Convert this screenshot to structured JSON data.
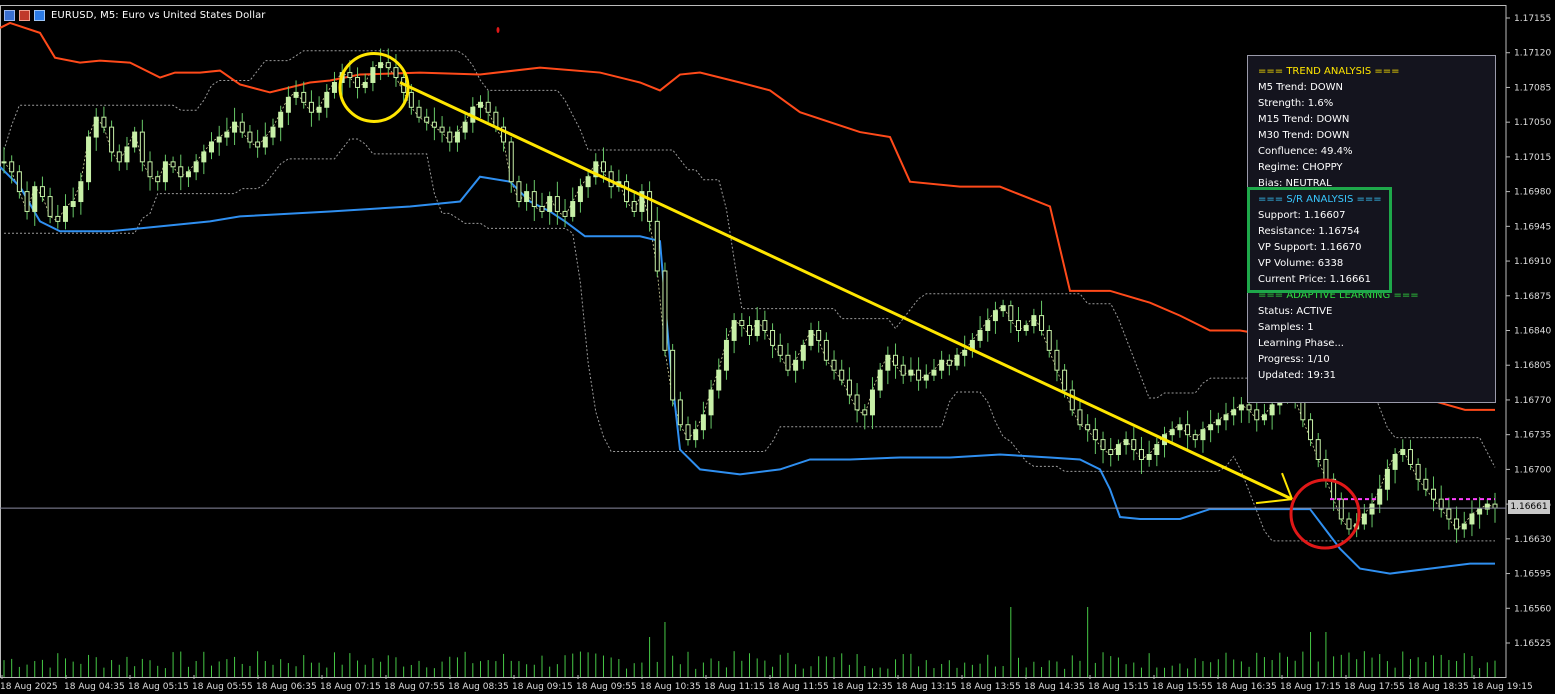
{
  "window": {
    "title": "EURUSD, M5:  Euro vs United States Dollar"
  },
  "colors": {
    "background": "#000000",
    "candle_up": "#c8f0a8",
    "wick": "#68c868",
    "upper_band": "#ff4a1a",
    "lower_band": "#2f8ff0",
    "envelope": "#9a9a9a",
    "trend_line": "#ffe600",
    "circle_top": "#ffe600",
    "circle_bottom": "#e01818",
    "magenta_level": "#ff40ff",
    "volume": "#46c846",
    "price_line": "#8a8aa0"
  },
  "price_axis": {
    "labels": [
      "1.17155",
      "1.17120",
      "1.17085",
      "1.17050",
      "1.17015",
      "1.16980",
      "1.16945",
      "1.16910",
      "1.16875",
      "1.16840",
      "1.16805",
      "1.16770",
      "1.16735",
      "1.16700",
      "1.16665",
      "1.16630",
      "1.16595",
      "1.16560",
      "1.16525"
    ],
    "values": [
      1.17155,
      1.1712,
      1.17085,
      1.1705,
      1.17015,
      1.1698,
      1.16945,
      1.1691,
      1.16875,
      1.1684,
      1.16805,
      1.1677,
      1.16735,
      1.167,
      1.16665,
      1.1663,
      1.16595,
      1.1656,
      1.16525
    ],
    "current_price_label": "1.16661",
    "current_price": 1.16661
  },
  "time_axis": {
    "labels": [
      "18 Aug 2025",
      "18 Aug 04:35",
      "18 Aug 05:15",
      "18 Aug 05:55",
      "18 Aug 06:35",
      "18 Aug 07:15",
      "18 Aug 07:55",
      "18 Aug 08:35",
      "18 Aug 09:15",
      "18 Aug 09:55",
      "18 Aug 10:35",
      "18 Aug 11:15",
      "18 Aug 11:55",
      "18 Aug 12:35",
      "18 Aug 13:15",
      "18 Aug 13:55",
      "18 Aug 14:35",
      "18 Aug 15:15",
      "18 Aug 15:55",
      "18 Aug 16:35",
      "18 Aug 17:15",
      "18 Aug 17:55",
      "18 Aug 18:35",
      "18 Aug 19:15"
    ]
  },
  "info_panel": {
    "trend_header": "=== TREND ANALYSIS ===",
    "trend_lines": [
      "M5 Trend: DOWN",
      "Strength: 1.6%",
      "M15 Trend: DOWN",
      "M30 Trend: DOWN",
      "Confluence: 49.4%",
      "Regime: CHOPPY",
      "Bias: NEUTRAL"
    ],
    "sr_header": "=== S/R ANALYSIS ===",
    "sr_lines": [
      "Support: 1.16607",
      "Resistance: 1.16754",
      "VP Support: 1.16670",
      "VP Volume: 6338",
      "Current Price: 1.16661"
    ],
    "learn_header": "=== ADAPTIVE LEARNING ===",
    "learn_lines": [
      "Status: ACTIVE",
      "Samples: 1",
      "Learning Phase...",
      "Progress: 1/10",
      "Updated: 19:31"
    ]
  },
  "chart_data": {
    "type": "candlestick",
    "symbol": "EURUSD",
    "timeframe": "M5",
    "ylim": [
      1.1651,
      1.1717
    ],
    "bar_count": 195,
    "closes": [
      1.1701,
      1.17,
      1.1698,
      1.1696,
      1.16985,
      1.16975,
      1.16955,
      1.1695,
      1.16965,
      1.1697,
      1.1699,
      1.17035,
      1.17055,
      1.17045,
      1.1702,
      1.1701,
      1.17025,
      1.1704,
      1.1701,
      1.16995,
      1.1699,
      1.1701,
      1.17005,
      1.16995,
      1.17,
      1.1701,
      1.1702,
      1.1703,
      1.17035,
      1.1704,
      1.1705,
      1.1704,
      1.1703,
      1.17025,
      1.17035,
      1.17045,
      1.1706,
      1.17075,
      1.1708,
      1.1707,
      1.1706,
      1.17065,
      1.1708,
      1.1709,
      1.171,
      1.17095,
      1.17085,
      1.1709,
      1.17105,
      1.1711,
      1.17105,
      1.17095,
      1.1708,
      1.17065,
      1.17055,
      1.1705,
      1.17045,
      1.1704,
      1.1703,
      1.1704,
      1.1705,
      1.17065,
      1.1707,
      1.1706,
      1.17045,
      1.1703,
      1.1699,
      1.1697,
      1.1698,
      1.16965,
      1.1696,
      1.16975,
      1.1696,
      1.16955,
      1.1697,
      1.16985,
      1.16995,
      1.1701,
      1.17,
      1.16985,
      1.1699,
      1.1697,
      1.1696,
      1.1698,
      1.1695,
      1.169,
      1.1682,
      1.1677,
      1.16745,
      1.1673,
      1.1674,
      1.16755,
      1.1678,
      1.168,
      1.1683,
      1.1685,
      1.16845,
      1.16835,
      1.1685,
      1.1684,
      1.16825,
      1.16815,
      1.168,
      1.1681,
      1.16825,
      1.1684,
      1.1683,
      1.1681,
      1.168,
      1.1679,
      1.16775,
      1.1676,
      1.16755,
      1.1678,
      1.168,
      1.16815,
      1.16805,
      1.16795,
      1.168,
      1.1679,
      1.16795,
      1.168,
      1.1681,
      1.16805,
      1.16815,
      1.1682,
      1.1683,
      1.1684,
      1.1685,
      1.1686,
      1.16865,
      1.1685,
      1.1684,
      1.16845,
      1.16855,
      1.1684,
      1.1682,
      1.168,
      1.1678,
      1.1676,
      1.16745,
      1.1674,
      1.1673,
      1.1672,
      1.16715,
      1.16725,
      1.1673,
      1.1672,
      1.1671,
      1.16715,
      1.16725,
      1.16735,
      1.1674,
      1.16745,
      1.16735,
      1.1673,
      1.1674,
      1.16745,
      1.1675,
      1.16755,
      1.1676,
      1.16765,
      1.1676,
      1.1675,
      1.16755,
      1.16765,
      1.16775,
      1.1678,
      1.1677,
      1.1675,
      1.1673,
      1.1671,
      1.1669,
      1.1667,
      1.1665,
      1.1664,
      1.16645,
      1.16655,
      1.16665,
      1.1668,
      1.167,
      1.16715,
      1.1672,
      1.16705,
      1.1669,
      1.1668,
      1.1667,
      1.1666,
      1.1665,
      1.1664,
      1.16645,
      1.16655,
      1.1666,
      1.16665,
      1.16661
    ],
    "upper_band": [
      [
        0,
        1.17145
      ],
      [
        10,
        1.1715
      ],
      [
        40,
        1.1714
      ],
      [
        55,
        1.17115
      ],
      [
        80,
        1.1711
      ],
      [
        100,
        1.17112
      ],
      [
        130,
        1.1711
      ],
      [
        160,
        1.17095
      ],
      [
        175,
        1.171
      ],
      [
        200,
        1.171
      ],
      [
        220,
        1.17102
      ],
      [
        240,
        1.17088
      ],
      [
        270,
        1.1708
      ],
      [
        310,
        1.1709
      ],
      [
        330,
        1.17092
      ],
      [
        360,
        1.17098
      ],
      [
        420,
        1.171
      ],
      [
        480,
        1.17098
      ],
      [
        540,
        1.17105
      ],
      [
        600,
        1.171
      ],
      [
        640,
        1.1709
      ],
      [
        660,
        1.17082
      ],
      [
        680,
        1.17098
      ],
      [
        700,
        1.171
      ],
      [
        740,
        1.1709
      ],
      [
        770,
        1.17082
      ],
      [
        800,
        1.1706
      ],
      [
        860,
        1.1704
      ],
      [
        890,
        1.17035
      ],
      [
        910,
        1.1699
      ],
      [
        960,
        1.16985
      ],
      [
        1000,
        1.16985
      ],
      [
        1050,
        1.16965
      ],
      [
        1070,
        1.1688
      ],
      [
        1110,
        1.1688
      ],
      [
        1150,
        1.16868
      ],
      [
        1180,
        1.16855
      ],
      [
        1210,
        1.1684
      ],
      [
        1240,
        1.1684
      ],
      [
        1270,
        1.16835
      ],
      [
        1290,
        1.1682
      ],
      [
        1300,
        1.168
      ],
      [
        1330,
        1.16775
      ],
      [
        1380,
        1.16775
      ],
      [
        1430,
        1.1677
      ],
      [
        1465,
        1.1676
      ],
      [
        1495,
        1.1676
      ]
    ],
    "lower_band": [
      [
        0,
        1.17005
      ],
      [
        20,
        1.16985
      ],
      [
        40,
        1.1695
      ],
      [
        60,
        1.1694
      ],
      [
        110,
        1.1694
      ],
      [
        160,
        1.16945
      ],
      [
        210,
        1.1695
      ],
      [
        240,
        1.16955
      ],
      [
        330,
        1.1696
      ],
      [
        410,
        1.16965
      ],
      [
        460,
        1.1697
      ],
      [
        480,
        1.16995
      ],
      [
        510,
        1.1699
      ],
      [
        530,
        1.1697
      ],
      [
        550,
        1.1696
      ],
      [
        565,
        1.1695
      ],
      [
        585,
        1.16935
      ],
      [
        640,
        1.16935
      ],
      [
        660,
        1.1693
      ],
      [
        670,
        1.1681
      ],
      [
        680,
        1.1672
      ],
      [
        700,
        1.167
      ],
      [
        740,
        1.16695
      ],
      [
        780,
        1.167
      ],
      [
        810,
        1.1671
      ],
      [
        850,
        1.1671
      ],
      [
        900,
        1.16712
      ],
      [
        950,
        1.16712
      ],
      [
        1000,
        1.16715
      ],
      [
        1050,
        1.16712
      ],
      [
        1080,
        1.1671
      ],
      [
        1100,
        1.167
      ],
      [
        1110,
        1.1668
      ],
      [
        1120,
        1.16652
      ],
      [
        1140,
        1.1665
      ],
      [
        1180,
        1.1665
      ],
      [
        1210,
        1.1666
      ],
      [
        1250,
        1.1666
      ],
      [
        1285,
        1.1666
      ],
      [
        1310,
        1.1666
      ],
      [
        1325,
        1.1664
      ],
      [
        1340,
        1.1662
      ],
      [
        1360,
        1.166
      ],
      [
        1390,
        1.16595
      ],
      [
        1430,
        1.166
      ],
      [
        1470,
        1.16605
      ],
      [
        1495,
        1.16605
      ]
    ],
    "trend_line": {
      "from": [
        400,
        1.1709
      ],
      "to": [
        1292,
        1.1667
      ]
    },
    "circle_top": {
      "x": 374,
      "price": 1.17085
    },
    "circle_bottom": {
      "x": 1325,
      "price": 1.16655
    },
    "magenta_level": 1.1667,
    "volume_max": 100
  }
}
